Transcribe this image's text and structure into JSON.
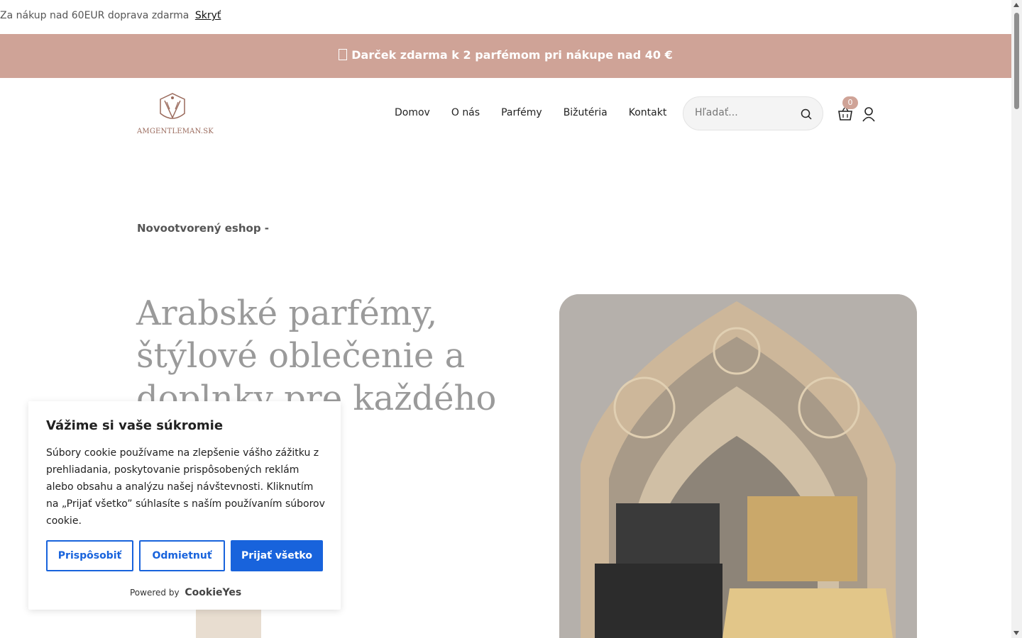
{
  "topbar": {
    "message": "Za nákup nad 60EUR doprava zdarma",
    "hide_label": "Skryť"
  },
  "promo": {
    "text": "Darček zdarma k 2 parfémom pri nákupe nad 40 €"
  },
  "header": {
    "logo_text": "AMGENTLEMAN.SK",
    "nav": [
      "Domov",
      "O nás",
      "Parfémy",
      "Bižutéria",
      "Kontakt"
    ],
    "search_placeholder": "Hľadať...",
    "cart_count": "0"
  },
  "hero": {
    "subtitle": "Novootvorený eshop -",
    "title": "Arabské parfémy, štýlové oblečenie a doplnky pre každého"
  },
  "cookie": {
    "title": "Vážime si vaše súkromie",
    "body": "Súbory cookie používame na zlepšenie vášho zážitku z prehliadania, poskytovanie prispôsobených reklám alebo obsahu a analýzu našej návštevnosti. Kliknutím na „Prijať všetko” súhlasíte s naším používaním súborov cookie.",
    "customize_label": "Prispôsobiť",
    "reject_label": "Odmietnuť",
    "accept_label": "Prijať všetko",
    "powered_by": "Powered by",
    "brand": "CookieYes"
  },
  "colors": {
    "promo_bg": "#cfa397",
    "accent_blue": "#1863dc",
    "logo_brown": "#9a6a5c"
  },
  "icons": {
    "search": "search-icon",
    "cart": "cart-icon",
    "user": "user-icon",
    "gift": "gift-icon"
  }
}
